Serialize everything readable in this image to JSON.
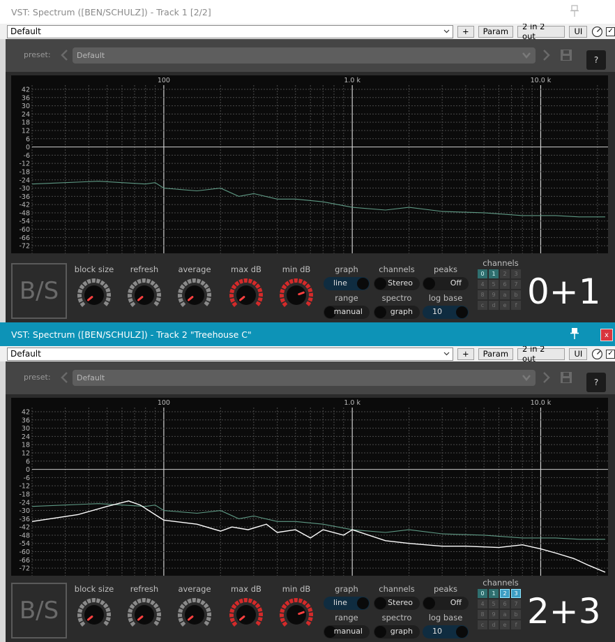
{
  "windows": [
    {
      "id": "w1",
      "title": "VST: Spectrum ([BEN/SCHULZ]) - Track 1 [2/2]",
      "toolbar": {
        "preset": "Default",
        "plus": "+",
        "param": "Param",
        "io": "2 in 2 out",
        "ui": "UI",
        "checkbox": "☑"
      },
      "preset_label": "preset:",
      "preset_value": "Default",
      "help": "?",
      "logo": "B/S",
      "controls": {
        "knobs": [
          {
            "label": "block size",
            "color": "#8a8a8a"
          },
          {
            "label": "refresh",
            "color": "#8a8a8a"
          },
          {
            "label": "average",
            "color": "#8a8a8a"
          },
          {
            "label": "max dB",
            "color": "#d42a2a"
          },
          {
            "label": "min dB",
            "color": "#d42a2a"
          }
        ],
        "toggles": [
          {
            "label": "graph",
            "value": "line",
            "on": true
          },
          {
            "label": "channels",
            "value": "Stereo",
            "on": false
          },
          {
            "label": "peaks",
            "value": "Off",
            "on": false
          },
          {
            "label": "range",
            "value": "manual",
            "on": false
          },
          {
            "label": "spectro",
            "value": "graph",
            "on": false
          },
          {
            "label": "log base",
            "value": "10",
            "on": true
          }
        ],
        "channels_label": "channels",
        "channel_cells": [
          "0",
          "1",
          "2",
          "3",
          "4",
          "5",
          "6",
          "7",
          "8",
          "9",
          "a",
          "b",
          "c",
          "d",
          "e",
          "f"
        ],
        "selected_channels": [
          "0",
          "1"
        ],
        "channel_display": "0+1"
      }
    },
    {
      "id": "w2",
      "title": "VST: Spectrum ([BEN/SCHULZ]) - Track 2 \"Treehouse C\"",
      "toolbar": {
        "preset": "Default",
        "plus": "+",
        "param": "Param",
        "io": "2 in 2 out",
        "ui": "UI",
        "checkbox": "☑"
      },
      "preset_label": "preset:",
      "preset_value": "Default",
      "help": "?",
      "close": "x",
      "logo": "B/S",
      "controls": {
        "knobs": [
          {
            "label": "block size",
            "color": "#8a8a8a"
          },
          {
            "label": "refresh",
            "color": "#8a8a8a"
          },
          {
            "label": "average",
            "color": "#8a8a8a"
          },
          {
            "label": "max dB",
            "color": "#d42a2a"
          },
          {
            "label": "min dB",
            "color": "#d42a2a"
          }
        ],
        "toggles": [
          {
            "label": "graph",
            "value": "line",
            "on": true
          },
          {
            "label": "channels",
            "value": "Stereo",
            "on": false
          },
          {
            "label": "peaks",
            "value": "Off",
            "on": false
          },
          {
            "label": "range",
            "value": "manual",
            "on": false
          },
          {
            "label": "spectro",
            "value": "graph",
            "on": false
          },
          {
            "label": "log base",
            "value": "10",
            "on": true
          }
        ],
        "channels_label": "channels",
        "channel_cells": [
          "0",
          "1",
          "2",
          "3",
          "4",
          "5",
          "6",
          "7",
          "8",
          "9",
          "a",
          "b",
          "c",
          "d",
          "e",
          "f"
        ],
        "selected_channels": [
          "0",
          "1",
          "2",
          "3"
        ],
        "highlight_channels": [
          "2",
          "3"
        ],
        "channel_display": "2+3"
      }
    }
  ],
  "chart_data": [
    {
      "type": "line",
      "x_scale": "log",
      "xlim": [
        20,
        22000
      ],
      "ylim": [
        -76,
        42
      ],
      "y_ticks": [
        42,
        36,
        30,
        24,
        18,
        12,
        6,
        0,
        -6,
        -12,
        -18,
        -24,
        -30,
        -36,
        -42,
        -48,
        -54,
        -60,
        -66,
        -72
      ],
      "x_tick_labels": [
        {
          "x": 100,
          "label": "100"
        },
        {
          "x": 1000,
          "label": "1.0 k"
        },
        {
          "x": 10000,
          "label": "10.0 k"
        }
      ],
      "grid": true,
      "series": [
        {
          "color": "#5f9a85",
          "x": [
            20,
            30,
            45,
            60,
            80,
            90,
            100,
            150,
            200,
            250,
            300,
            400,
            500,
            700,
            1000,
            1500,
            2000,
            3000,
            5000,
            8000,
            12000,
            16000,
            22000
          ],
          "y": [
            -27,
            -26,
            -25,
            -26,
            -27,
            -26,
            -30,
            -32,
            -30,
            -36,
            -34,
            -38,
            -38,
            -40,
            -44,
            -46,
            -44,
            -47,
            -48,
            -50,
            -50,
            -51,
            -51
          ]
        }
      ]
    },
    {
      "type": "line",
      "x_scale": "log",
      "xlim": [
        20,
        22000
      ],
      "ylim": [
        -76,
        42
      ],
      "y_ticks": [
        42,
        36,
        30,
        24,
        18,
        12,
        6,
        0,
        -6,
        -12,
        -18,
        -24,
        -30,
        -36,
        -42,
        -48,
        -54,
        -60,
        -66,
        -72
      ],
      "x_tick_labels": [
        {
          "x": 100,
          "label": "100"
        },
        {
          "x": 1000,
          "label": "1.0 k"
        },
        {
          "x": 10000,
          "label": "10.0 k"
        }
      ],
      "grid": true,
      "series": [
        {
          "color": "#5f9a85",
          "x": [
            20,
            30,
            45,
            60,
            80,
            90,
            100,
            150,
            200,
            250,
            300,
            400,
            500,
            700,
            1000,
            1500,
            2000,
            3000,
            5000,
            8000,
            12000,
            16000,
            22000
          ],
          "y": [
            -27,
            -26,
            -25,
            -26,
            -27,
            -26,
            -30,
            -32,
            -30,
            -36,
            -34,
            -38,
            -38,
            -40,
            -44,
            -46,
            -44,
            -47,
            -48,
            -50,
            -50,
            -51,
            -51
          ]
        },
        {
          "color": "#ffffff",
          "x": [
            20,
            35,
            50,
            65,
            75,
            90,
            100,
            150,
            200,
            230,
            280,
            350,
            400,
            500,
            600,
            700,
            900,
            1000,
            1500,
            2000,
            3000,
            4000,
            6000,
            8000,
            10000,
            12000,
            15000,
            18000,
            22000
          ],
          "y": [
            -38,
            -33,
            -27,
            -23,
            -26,
            -33,
            -37,
            -40,
            -45,
            -42,
            -44,
            -40,
            -46,
            -44,
            -50,
            -44,
            -48,
            -44,
            -52,
            -54,
            -56,
            -56,
            -57,
            -55,
            -58,
            -61,
            -65,
            -70,
            -75
          ]
        }
      ]
    }
  ]
}
